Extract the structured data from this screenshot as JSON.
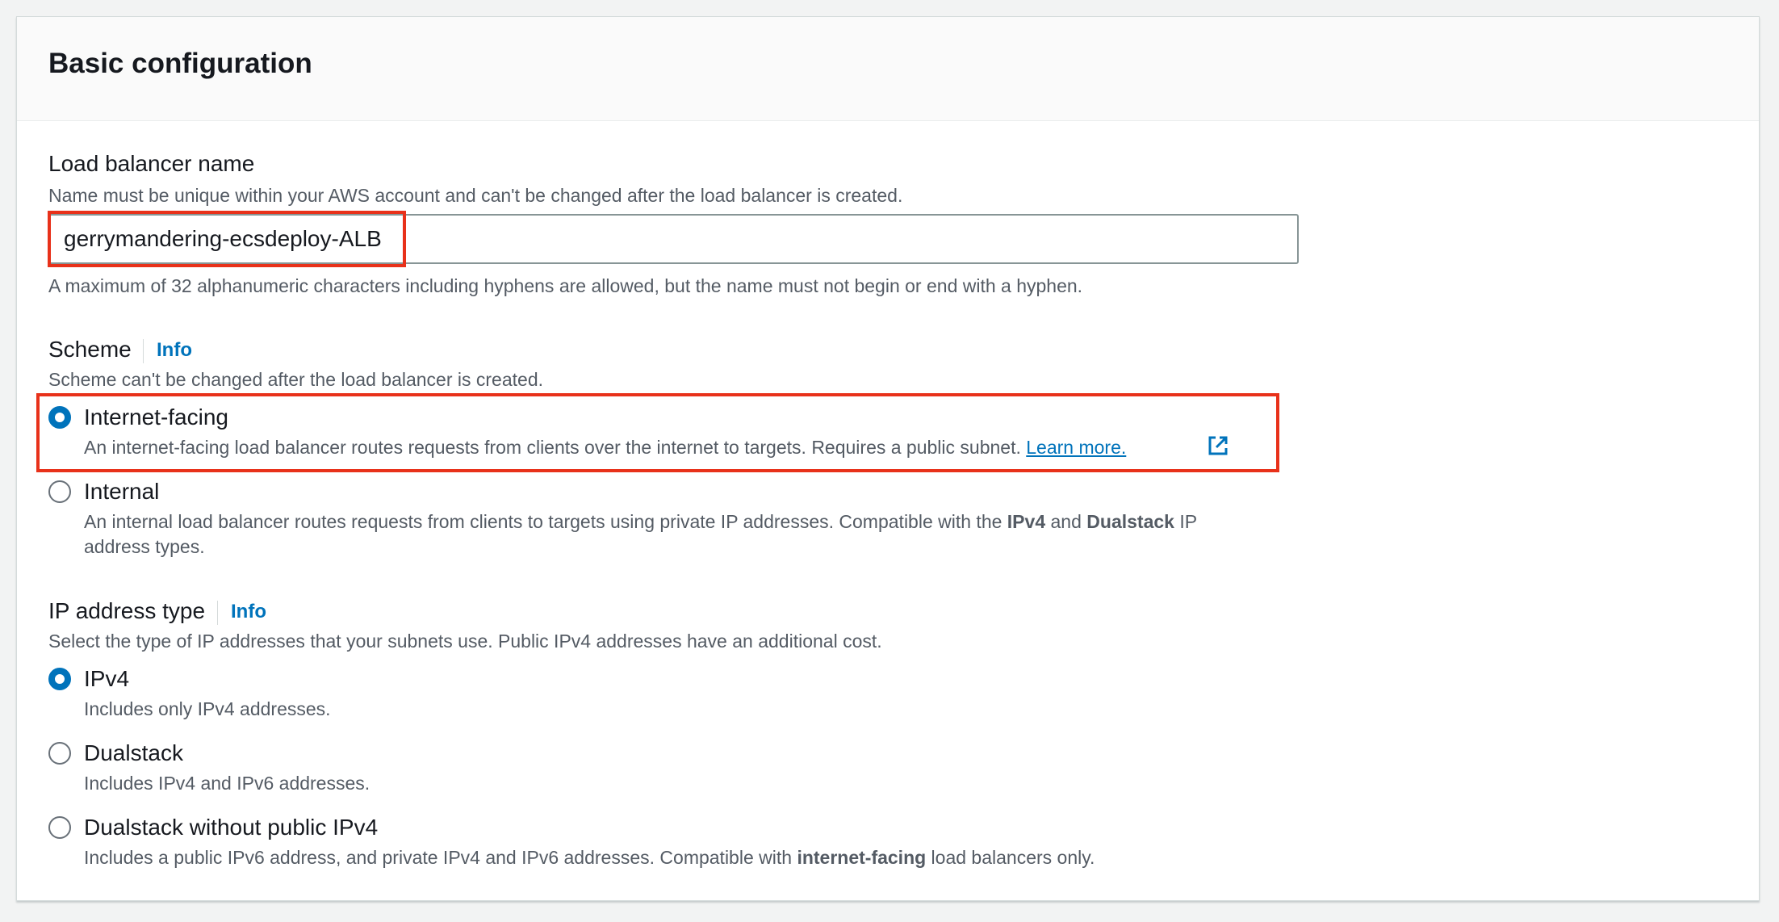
{
  "section": {
    "title": "Basic configuration"
  },
  "name_field": {
    "label": "Load balancer name",
    "description": "Name must be unique within your AWS account and can't be changed after the load balancer is created.",
    "value": "gerrymandering-ecsdeploy-ALB",
    "constraint": "A maximum of 32 alphanumeric characters including hyphens are allowed, but the name must not begin or end with a hyphen."
  },
  "scheme": {
    "label": "Scheme",
    "info": "Info",
    "description": "Scheme can't be changed after the load balancer is created.",
    "selected": "Internet-facing",
    "options": [
      {
        "label": "Internet-facing",
        "description": "An internet-facing load balancer routes requests from clients over the internet to targets. Requires a public subnet.",
        "link": "Learn more.",
        "checked": true
      },
      {
        "label": "Internal",
        "description_pre": "An internal load balancer routes requests from clients to targets using private IP addresses. Compatible with the ",
        "bold1": "IPv4",
        "mid": " and ",
        "bold2": "Dualstack",
        "description_post": " IP",
        "description_line2": "address types.",
        "checked": false
      }
    ]
  },
  "ip_type": {
    "label": "IP address type",
    "info": "Info",
    "description": "Select the type of IP addresses that your subnets use. Public IPv4 addresses have an additional cost.",
    "selected": "IPv4",
    "options": [
      {
        "label": "IPv4",
        "description": "Includes only IPv4 addresses.",
        "checked": true
      },
      {
        "label": "Dualstack",
        "description": "Includes IPv4 and IPv6 addresses.",
        "checked": false
      },
      {
        "label": "Dualstack without public IPv4",
        "description_pre": "Includes a public IPv6 address, and private IPv4 and IPv6 addresses. Compatible with ",
        "bold": "internet-facing",
        "description_post": " load balancers only.",
        "checked": false
      }
    ]
  },
  "colors": {
    "accent": "#0073bb",
    "annotation": "#e8311a",
    "text": "#16191f",
    "muted": "#545b64"
  },
  "icons": {
    "external": "external-link-icon"
  }
}
